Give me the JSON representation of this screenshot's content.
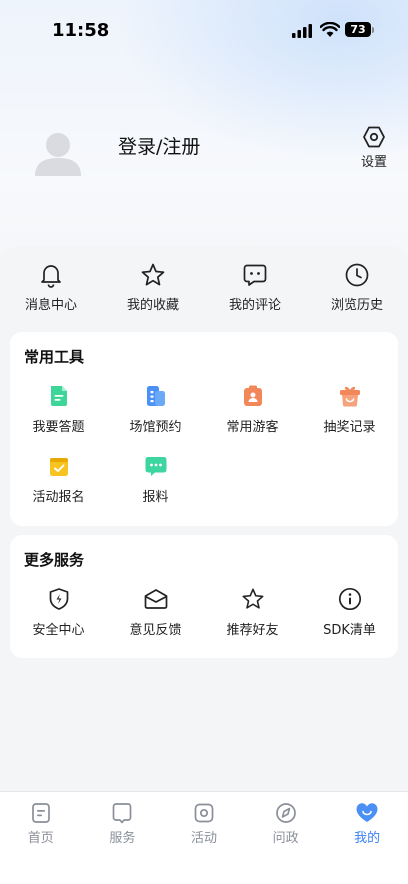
{
  "status_bar": {
    "time": "11:58",
    "battery": "73"
  },
  "profile": {
    "login_label": "登录/注册",
    "settings_label": "设置"
  },
  "quick_actions": [
    {
      "label": "消息中心",
      "icon": "bell-icon"
    },
    {
      "label": "我的收藏",
      "icon": "star-icon"
    },
    {
      "label": "我的评论",
      "icon": "comment-icon"
    },
    {
      "label": "浏览历史",
      "icon": "clock-icon"
    }
  ],
  "tools": {
    "title": "常用工具",
    "items": [
      {
        "label": "我要答题",
        "icon": "document-icon",
        "color": "#3dd598"
      },
      {
        "label": "场馆预约",
        "icon": "venue-icon",
        "color": "#4a90f5"
      },
      {
        "label": "常用游客",
        "icon": "visitor-icon",
        "color": "#f2875a"
      },
      {
        "label": "抽奖记录",
        "icon": "lottery-icon",
        "color": "#f2875a"
      },
      {
        "label": "活动报名",
        "icon": "signup-icon",
        "color": "#f7c320"
      },
      {
        "label": "报料",
        "icon": "chat-report-icon",
        "color": "#3dd5a0"
      }
    ]
  },
  "services": {
    "title": "更多服务",
    "items": [
      {
        "label": "安全中心",
        "icon": "shield-icon"
      },
      {
        "label": "意见反馈",
        "icon": "envelope-icon"
      },
      {
        "label": "推荐好友",
        "icon": "star-icon"
      },
      {
        "label": "SDK清单",
        "icon": "info-icon"
      }
    ]
  },
  "tabbar": [
    {
      "label": "首页",
      "icon": "home-icon",
      "active": false
    },
    {
      "label": "服务",
      "icon": "service-icon",
      "active": false
    },
    {
      "label": "活动",
      "icon": "activity-icon",
      "active": false
    },
    {
      "label": "问政",
      "icon": "compass-icon",
      "active": false
    },
    {
      "label": "我的",
      "icon": "heart-icon",
      "active": true
    }
  ],
  "colors": {
    "accent": "#3b82f6",
    "inactive_tab": "#8a8f99"
  }
}
